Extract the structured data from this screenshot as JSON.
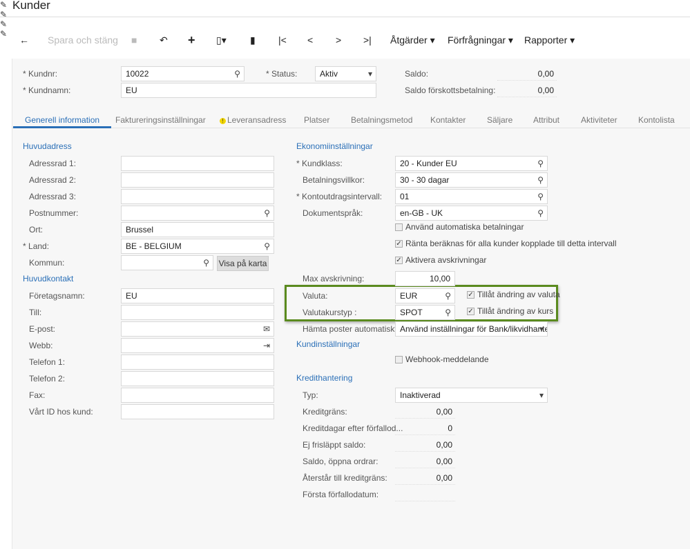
{
  "title": "Kunder",
  "toolbar": {
    "save_close": "Spara och stäng",
    "actions": "Åtgärder ▾",
    "inquiries": "Förfrågningar ▾",
    "reports": "Rapporter ▾"
  },
  "header": {
    "customer_no_label": "Kundnr:",
    "customer_no": "10022",
    "customer_name_label": "Kundnamn:",
    "customer_name": "EU",
    "status_label": "Status:",
    "status": "Aktiv",
    "balance_label": "Saldo:",
    "balance": "0,00",
    "prepay_label": "Saldo förskottsbetalning:",
    "prepay": "0,00"
  },
  "tabs": [
    "Generell information",
    "Faktureringsinställningar",
    "Leveransadress",
    "Platser",
    "Betalningsmetod",
    "Kontakter",
    "Säljare",
    "Attribut",
    "Aktiviteter",
    "Kontolista"
  ],
  "address": {
    "title": "Huvudadress",
    "fields": [
      {
        "label": "Adressrad 1:",
        "value": ""
      },
      {
        "label": "Adressrad 2:",
        "value": ""
      },
      {
        "label": "Adressrad 3:",
        "value": ""
      },
      {
        "label": "Postnummer:",
        "value": ""
      },
      {
        "label": "Ort:",
        "value": "Brussel"
      },
      {
        "label": "Land:",
        "value": "BE - BELGIUM"
      },
      {
        "label": "Kommun:",
        "value": ""
      }
    ],
    "map_button": "Visa på karta"
  },
  "contact": {
    "title": "Huvudkontakt",
    "fields": [
      {
        "label": "Företagsnamn:",
        "value": "EU"
      },
      {
        "label": "Till:",
        "value": ""
      },
      {
        "label": "E-post:",
        "value": ""
      },
      {
        "label": "Webb:",
        "value": ""
      },
      {
        "label": "Telefon 1:",
        "value": ""
      },
      {
        "label": "Telefon 2:",
        "value": ""
      },
      {
        "label": "Fax:",
        "value": ""
      },
      {
        "label": "Vårt ID hos kund:",
        "value": ""
      }
    ]
  },
  "finance": {
    "title": "Ekonomiinställningar",
    "fields": [
      {
        "label": "Kundklass:",
        "value": "20 - Kunder EU"
      },
      {
        "label": "Betalningsvillkor:",
        "value": "30 - 30 dagar"
      },
      {
        "label": "Kontoutdragsintervall:",
        "value": "01"
      },
      {
        "label": "Dokumentspråk:",
        "value": "en-GB - UK"
      }
    ],
    "checks": [
      {
        "label": "Använd automatiska betalningar",
        "checked": false
      },
      {
        "label": "Ränta beräknas för alla kunder kopplade till detta intervall",
        "checked": true
      },
      {
        "label": "Aktivera avskrivningar",
        "checked": true
      }
    ],
    "max_writeoff_label": "Max avskrivning:",
    "max_writeoff": "10,00",
    "currency_label": "Valuta:",
    "currency": "EUR",
    "allow_currency": "Tillåt ändring av valuta",
    "rate_type_label": "Valutakurstyp :",
    "rate_type": "SPOT",
    "allow_rate": "Tillåt ändring av kurs",
    "fetch_label": "Hämta poster automatiskt:",
    "fetch": "Använd inställningar för Bank/likvidhanteri"
  },
  "customer_settings": {
    "title": "Kundinställningar",
    "webhook": "Webhook-meddelande"
  },
  "credit": {
    "title": "Kredithantering",
    "type_label": "Typ:",
    "type": "Inaktiverad",
    "rows": [
      {
        "label": "Kreditgräns:",
        "value": "0,00"
      },
      {
        "label": "Kreditdagar efter förfallod...",
        "value": "0"
      },
      {
        "label": "Ej frisläppt saldo:",
        "value": "0,00"
      },
      {
        "label": "Saldo, öppna ordrar:",
        "value": "0,00"
      },
      {
        "label": "Återstår till kreditgräns:",
        "value": "0,00"
      },
      {
        "label": "Första förfallodatum:",
        "value": ""
      }
    ]
  },
  "colors": {
    "accent": "#2a6fb7",
    "highlight": "#5a8a1e"
  }
}
